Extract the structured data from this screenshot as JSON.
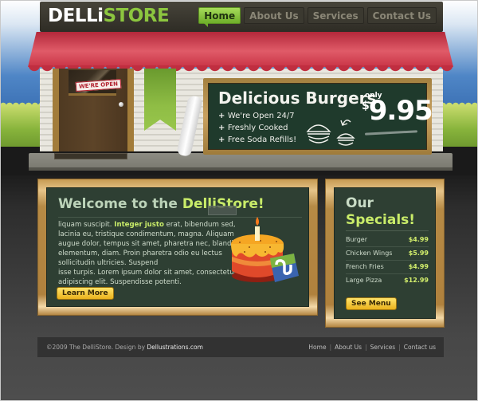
{
  "logo": {
    "part1": "DELLi",
    "part2": "STORE"
  },
  "nav": [
    {
      "label": "Home",
      "active": true
    },
    {
      "label": "About Us",
      "active": false
    },
    {
      "label": "Services",
      "active": false
    },
    {
      "label": "Contact Us",
      "active": false
    }
  ],
  "storefront": {
    "open_sign": "WE'RE OPEN",
    "chalkboard": {
      "title": "Delicious Burgers",
      "features": [
        "We're Open 24/7",
        "Freshly Cooked",
        "Free Soda Refills!"
      ],
      "price_prefix": "only",
      "currency": "$",
      "price": "9.95"
    }
  },
  "welcome": {
    "title_part1": "Welcome to the ",
    "title_part2": "DelliStore!",
    "body_lead": "liquam suscipit. ",
    "body_bold": "Integer justo",
    "body_line1_rest": " erat, bibendum sed, lacinia eu, tristique condimentum, magna. Aliquam augue dolor, tempus sit amet, pharetra nec, blandit elementum, diam. Proin pharetra odio eu lectus sollicitudin ultricies. Suspend",
    "body_line2": "isse turpis. Lorem ipsum dolor sit amet, consectetur adipiscing elit. Suspendisse potenti.",
    "button": "Learn More"
  },
  "specials": {
    "title_part1": "Our",
    "title_part2": "Specials!",
    "items": [
      {
        "name": "Burger",
        "price": "$4.99"
      },
      {
        "name": "Chicken Wings",
        "price": "$5.99"
      },
      {
        "name": "French Fries",
        "price": "$4.99"
      },
      {
        "name": "Large Pizza",
        "price": "$12.99"
      }
    ],
    "button": "See Menu"
  },
  "footer": {
    "copyright": "©2009 The DelliStore. Design by ",
    "designer": "Dellustrations.com",
    "links": [
      "Home",
      "About Us",
      "Services",
      "Contact us"
    ]
  },
  "colors": {
    "accent_green": "#8cc63f",
    "highlight_green": "#c9ec69",
    "chalkboard": "#2e3f33",
    "awning_red": "#c93446",
    "button_gold": "#eab21d"
  }
}
